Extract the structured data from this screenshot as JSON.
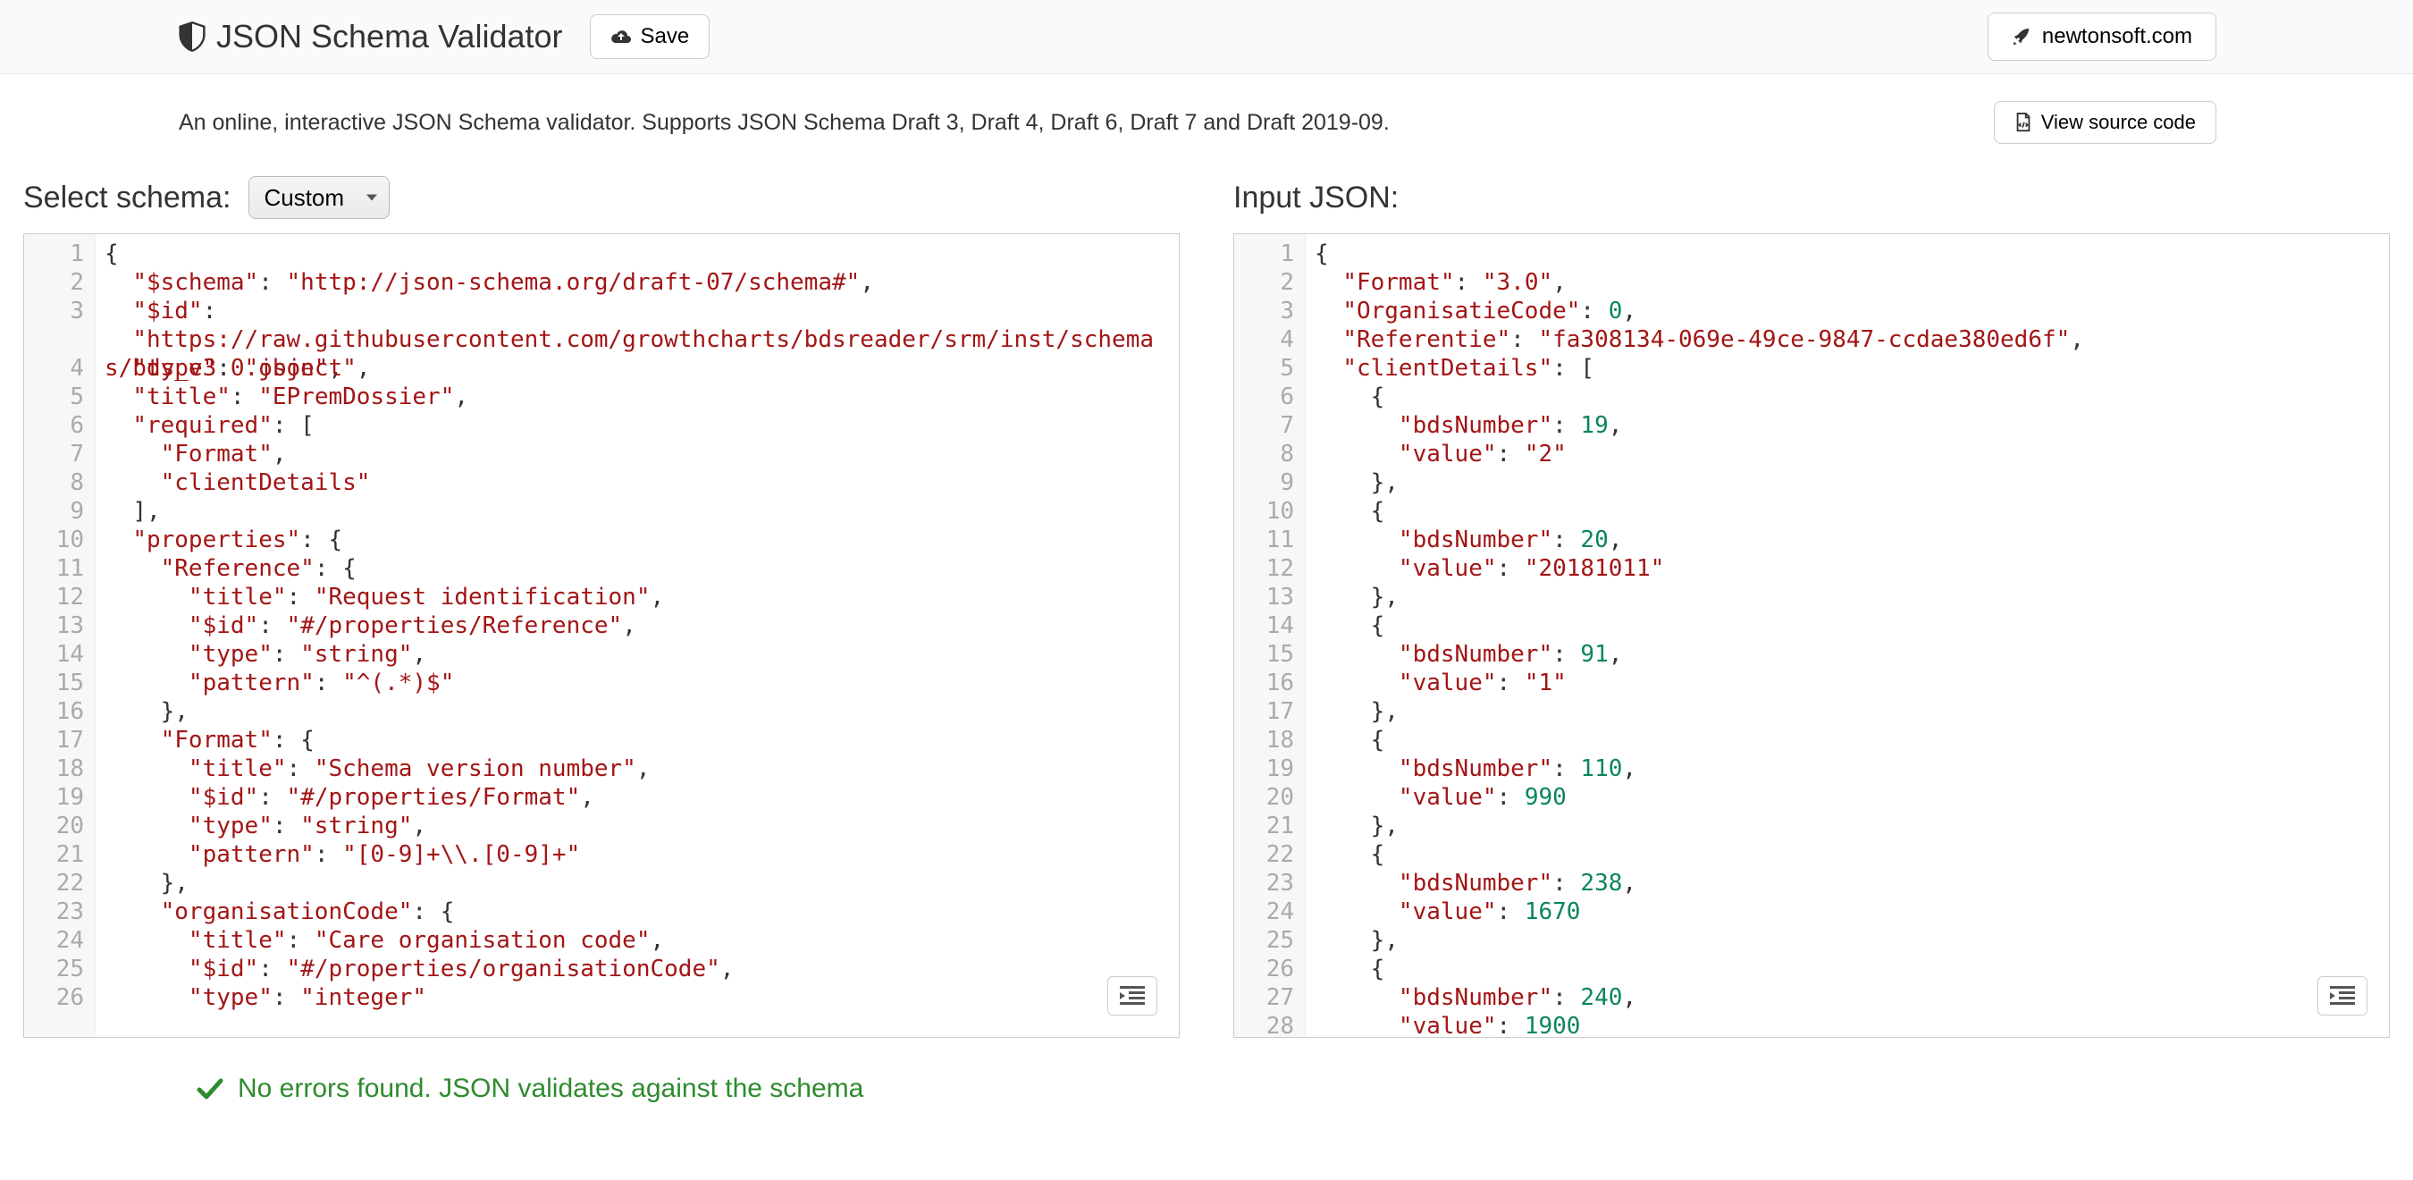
{
  "header": {
    "title": "JSON Schema Validator",
    "save_label": "Save",
    "newton_label": "newtonsoft.com"
  },
  "subbar": {
    "description": "An online, interactive JSON Schema validator. Supports JSON Schema Draft 3, Draft 4, Draft 6, Draft 7 and Draft 2019-09.",
    "view_source_label": "View source code"
  },
  "left": {
    "label": "Select schema:",
    "select_value": "Custom",
    "lines": [
      "1",
      "2",
      "3",
      "",
      "4",
      "5",
      "6",
      "7",
      "8",
      "9",
      "10",
      "11",
      "12",
      "13",
      "14",
      "15",
      "16",
      "17",
      "18",
      "19",
      "20",
      "21",
      "22",
      "23",
      "24",
      "25",
      "26"
    ],
    "code_tokens": [
      [
        {
          "t": "{",
          "c": "p"
        }
      ],
      [
        {
          "t": "  ",
          "c": "p"
        },
        {
          "t": "\"$schema\"",
          "c": "s"
        },
        {
          "t": ": ",
          "c": "p"
        },
        {
          "t": "\"http://json-schema.org/draft-07/schema#\"",
          "c": "s"
        },
        {
          "t": ",",
          "c": "p"
        }
      ],
      [
        {
          "t": "  ",
          "c": "p"
        },
        {
          "t": "\"$id\"",
          "c": "s"
        },
        {
          "t": ":",
          "c": "p"
        }
      ],
      [
        {
          "t": "  ",
          "c": "p"
        },
        {
          "t": "\"https://raw.githubusercontent.com/growthcharts/bdsreader/srm/inst/schemas/bds_v3.0.json\"",
          "c": "s"
        },
        {
          "t": ",",
          "c": "p"
        }
      ],
      [
        {
          "t": "  ",
          "c": "p"
        },
        {
          "t": "\"type\"",
          "c": "s"
        },
        {
          "t": ": ",
          "c": "p"
        },
        {
          "t": "\"object\"",
          "c": "s"
        },
        {
          "t": ",",
          "c": "p"
        }
      ],
      [
        {
          "t": "  ",
          "c": "p"
        },
        {
          "t": "\"title\"",
          "c": "s"
        },
        {
          "t": ": ",
          "c": "p"
        },
        {
          "t": "\"EPremDossier\"",
          "c": "s"
        },
        {
          "t": ",",
          "c": "p"
        }
      ],
      [
        {
          "t": "  ",
          "c": "p"
        },
        {
          "t": "\"required\"",
          "c": "s"
        },
        {
          "t": ": [",
          "c": "p"
        }
      ],
      [
        {
          "t": "    ",
          "c": "p"
        },
        {
          "t": "\"Format\"",
          "c": "s"
        },
        {
          "t": ",",
          "c": "p"
        }
      ],
      [
        {
          "t": "    ",
          "c": "p"
        },
        {
          "t": "\"clientDetails\"",
          "c": "s"
        }
      ],
      [
        {
          "t": "  ],",
          "c": "p"
        }
      ],
      [
        {
          "t": "  ",
          "c": "p"
        },
        {
          "t": "\"properties\"",
          "c": "s"
        },
        {
          "t": ": {",
          "c": "p"
        }
      ],
      [
        {
          "t": "    ",
          "c": "p"
        },
        {
          "t": "\"Reference\"",
          "c": "s"
        },
        {
          "t": ": {",
          "c": "p"
        }
      ],
      [
        {
          "t": "      ",
          "c": "p"
        },
        {
          "t": "\"title\"",
          "c": "s"
        },
        {
          "t": ": ",
          "c": "p"
        },
        {
          "t": "\"Request identification\"",
          "c": "s"
        },
        {
          "t": ",",
          "c": "p"
        }
      ],
      [
        {
          "t": "      ",
          "c": "p"
        },
        {
          "t": "\"$id\"",
          "c": "s"
        },
        {
          "t": ": ",
          "c": "p"
        },
        {
          "t": "\"#/properties/Reference\"",
          "c": "s"
        },
        {
          "t": ",",
          "c": "p"
        }
      ],
      [
        {
          "t": "      ",
          "c": "p"
        },
        {
          "t": "\"type\"",
          "c": "s"
        },
        {
          "t": ": ",
          "c": "p"
        },
        {
          "t": "\"string\"",
          "c": "s"
        },
        {
          "t": ",",
          "c": "p"
        }
      ],
      [
        {
          "t": "      ",
          "c": "p"
        },
        {
          "t": "\"pattern\"",
          "c": "s"
        },
        {
          "t": ": ",
          "c": "p"
        },
        {
          "t": "\"^(.*)$\"",
          "c": "s"
        }
      ],
      [
        {
          "t": "    },",
          "c": "p"
        }
      ],
      [
        {
          "t": "    ",
          "c": "p"
        },
        {
          "t": "\"Format\"",
          "c": "s"
        },
        {
          "t": ": {",
          "c": "p"
        }
      ],
      [
        {
          "t": "      ",
          "c": "p"
        },
        {
          "t": "\"title\"",
          "c": "s"
        },
        {
          "t": ": ",
          "c": "p"
        },
        {
          "t": "\"Schema version number\"",
          "c": "s"
        },
        {
          "t": ",",
          "c": "p"
        }
      ],
      [
        {
          "t": "      ",
          "c": "p"
        },
        {
          "t": "\"$id\"",
          "c": "s"
        },
        {
          "t": ": ",
          "c": "p"
        },
        {
          "t": "\"#/properties/Format\"",
          "c": "s"
        },
        {
          "t": ",",
          "c": "p"
        }
      ],
      [
        {
          "t": "      ",
          "c": "p"
        },
        {
          "t": "\"type\"",
          "c": "s"
        },
        {
          "t": ": ",
          "c": "p"
        },
        {
          "t": "\"string\"",
          "c": "s"
        },
        {
          "t": ",",
          "c": "p"
        }
      ],
      [
        {
          "t": "      ",
          "c": "p"
        },
        {
          "t": "\"pattern\"",
          "c": "s"
        },
        {
          "t": ": ",
          "c": "p"
        },
        {
          "t": "\"[0-9]+\\\\.[0-9]+\"",
          "c": "s"
        }
      ],
      [
        {
          "t": "    },",
          "c": "p"
        }
      ],
      [
        {
          "t": "    ",
          "c": "p"
        },
        {
          "t": "\"organisationCode\"",
          "c": "s"
        },
        {
          "t": ": {",
          "c": "p"
        }
      ],
      [
        {
          "t": "      ",
          "c": "p"
        },
        {
          "t": "\"title\"",
          "c": "s"
        },
        {
          "t": ": ",
          "c": "p"
        },
        {
          "t": "\"Care organisation code\"",
          "c": "s"
        },
        {
          "t": ",",
          "c": "p"
        }
      ],
      [
        {
          "t": "      ",
          "c": "p"
        },
        {
          "t": "\"$id\"",
          "c": "s"
        },
        {
          "t": ": ",
          "c": "p"
        },
        {
          "t": "\"#/properties/organisationCode\"",
          "c": "s"
        },
        {
          "t": ",",
          "c": "p"
        }
      ],
      [
        {
          "t": "      ",
          "c": "p"
        },
        {
          "t": "\"type\"",
          "c": "s"
        },
        {
          "t": ": ",
          "c": "p"
        },
        {
          "t": "\"integer\"",
          "c": "s"
        }
      ]
    ]
  },
  "right": {
    "label": "Input JSON:",
    "lines": [
      "1",
      "2",
      "3",
      "4",
      "5",
      "6",
      "7",
      "8",
      "9",
      "10",
      "11",
      "12",
      "13",
      "14",
      "15",
      "16",
      "17",
      "18",
      "19",
      "20",
      "21",
      "22",
      "23",
      "24",
      "25",
      "26",
      "27",
      "28"
    ],
    "code_tokens": [
      [
        {
          "t": "{",
          "c": "p"
        }
      ],
      [
        {
          "t": "  ",
          "c": "p"
        },
        {
          "t": "\"Format\"",
          "c": "s"
        },
        {
          "t": ": ",
          "c": "p"
        },
        {
          "t": "\"3.0\"",
          "c": "s"
        },
        {
          "t": ",",
          "c": "p"
        }
      ],
      [
        {
          "t": "  ",
          "c": "p"
        },
        {
          "t": "\"OrganisatieCode\"",
          "c": "s"
        },
        {
          "t": ": ",
          "c": "p"
        },
        {
          "t": "0",
          "c": "n"
        },
        {
          "t": ",",
          "c": "p"
        }
      ],
      [
        {
          "t": "  ",
          "c": "p"
        },
        {
          "t": "\"Referentie\"",
          "c": "s"
        },
        {
          "t": ": ",
          "c": "p"
        },
        {
          "t": "\"fa308134-069e-49ce-9847-ccdae380ed6f\"",
          "c": "s"
        },
        {
          "t": ",",
          "c": "p"
        }
      ],
      [
        {
          "t": "  ",
          "c": "p"
        },
        {
          "t": "\"clientDetails\"",
          "c": "s"
        },
        {
          "t": ": [",
          "c": "p"
        }
      ],
      [
        {
          "t": "    {",
          "c": "p"
        }
      ],
      [
        {
          "t": "      ",
          "c": "p"
        },
        {
          "t": "\"bdsNumber\"",
          "c": "s"
        },
        {
          "t": ": ",
          "c": "p"
        },
        {
          "t": "19",
          "c": "n"
        },
        {
          "t": ",",
          "c": "p"
        }
      ],
      [
        {
          "t": "      ",
          "c": "p"
        },
        {
          "t": "\"value\"",
          "c": "s"
        },
        {
          "t": ": ",
          "c": "p"
        },
        {
          "t": "\"2\"",
          "c": "s"
        }
      ],
      [
        {
          "t": "    },",
          "c": "p"
        }
      ],
      [
        {
          "t": "    {",
          "c": "p"
        }
      ],
      [
        {
          "t": "      ",
          "c": "p"
        },
        {
          "t": "\"bdsNumber\"",
          "c": "s"
        },
        {
          "t": ": ",
          "c": "p"
        },
        {
          "t": "20",
          "c": "n"
        },
        {
          "t": ",",
          "c": "p"
        }
      ],
      [
        {
          "t": "      ",
          "c": "p"
        },
        {
          "t": "\"value\"",
          "c": "s"
        },
        {
          "t": ": ",
          "c": "p"
        },
        {
          "t": "\"20181011\"",
          "c": "s"
        }
      ],
      [
        {
          "t": "    },",
          "c": "p"
        }
      ],
      [
        {
          "t": "    {",
          "c": "p"
        }
      ],
      [
        {
          "t": "      ",
          "c": "p"
        },
        {
          "t": "\"bdsNumber\"",
          "c": "s"
        },
        {
          "t": ": ",
          "c": "p"
        },
        {
          "t": "91",
          "c": "n"
        },
        {
          "t": ",",
          "c": "p"
        }
      ],
      [
        {
          "t": "      ",
          "c": "p"
        },
        {
          "t": "\"value\"",
          "c": "s"
        },
        {
          "t": ": ",
          "c": "p"
        },
        {
          "t": "\"1\"",
          "c": "s"
        }
      ],
      [
        {
          "t": "    },",
          "c": "p"
        }
      ],
      [
        {
          "t": "    {",
          "c": "p"
        }
      ],
      [
        {
          "t": "      ",
          "c": "p"
        },
        {
          "t": "\"bdsNumber\"",
          "c": "s"
        },
        {
          "t": ": ",
          "c": "p"
        },
        {
          "t": "110",
          "c": "n"
        },
        {
          "t": ",",
          "c": "p"
        }
      ],
      [
        {
          "t": "      ",
          "c": "p"
        },
        {
          "t": "\"value\"",
          "c": "s"
        },
        {
          "t": ": ",
          "c": "p"
        },
        {
          "t": "990",
          "c": "n"
        }
      ],
      [
        {
          "t": "    },",
          "c": "p"
        }
      ],
      [
        {
          "t": "    {",
          "c": "p"
        }
      ],
      [
        {
          "t": "      ",
          "c": "p"
        },
        {
          "t": "\"bdsNumber\"",
          "c": "s"
        },
        {
          "t": ": ",
          "c": "p"
        },
        {
          "t": "238",
          "c": "n"
        },
        {
          "t": ",",
          "c": "p"
        }
      ],
      [
        {
          "t": "      ",
          "c": "p"
        },
        {
          "t": "\"value\"",
          "c": "s"
        },
        {
          "t": ": ",
          "c": "p"
        },
        {
          "t": "1670",
          "c": "n"
        }
      ],
      [
        {
          "t": "    },",
          "c": "p"
        }
      ],
      [
        {
          "t": "    {",
          "c": "p"
        }
      ],
      [
        {
          "t": "      ",
          "c": "p"
        },
        {
          "t": "\"bdsNumber\"",
          "c": "s"
        },
        {
          "t": ": ",
          "c": "p"
        },
        {
          "t": "240",
          "c": "n"
        },
        {
          "t": ",",
          "c": "p"
        }
      ],
      [
        {
          "t": "      ",
          "c": "p"
        },
        {
          "t": "\"value\"",
          "c": "s"
        },
        {
          "t": ": ",
          "c": "p"
        },
        {
          "t": "1900",
          "c": "n"
        }
      ]
    ]
  },
  "status": {
    "message": "No errors found. JSON validates against the schema"
  }
}
